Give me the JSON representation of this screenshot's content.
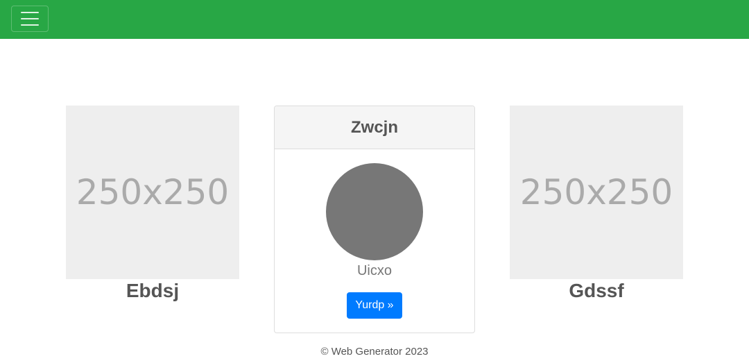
{
  "navbar": {
    "background": "#28a745",
    "toggle_icon": "hamburger-menu-icon"
  },
  "left_item": {
    "placeholder_text": "250x250",
    "caption": "Ebdsj"
  },
  "card": {
    "title": "Zwcjn",
    "avatar_color": "#777777",
    "subtitle": "Uicxo",
    "button_label": "Yurdp »",
    "button_color": "#007bff"
  },
  "right_item": {
    "placeholder_text": "250x250",
    "caption": "Gdssf"
  },
  "footer": {
    "text": "© Web Generator 2023"
  }
}
